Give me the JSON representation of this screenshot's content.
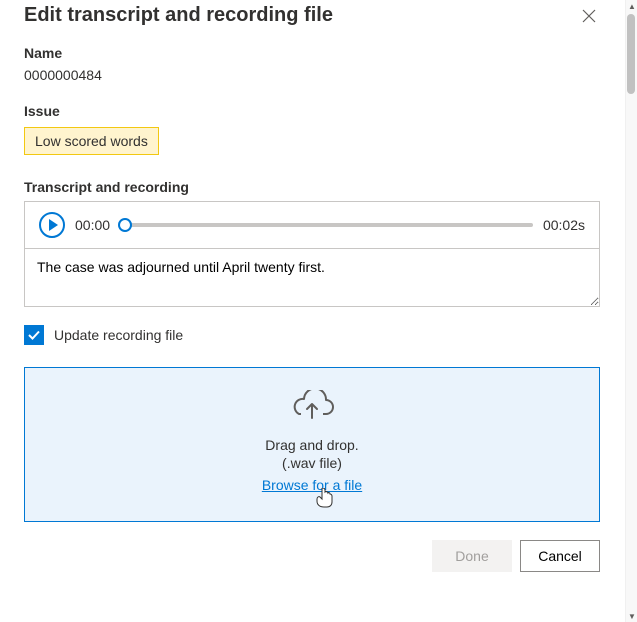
{
  "dialog": {
    "title": "Edit transcript and recording file"
  },
  "name": {
    "label": "Name",
    "value": "0000000484"
  },
  "issue": {
    "label": "Issue",
    "chips": [
      "Low scored words"
    ]
  },
  "transcript": {
    "label": "Transcript and recording",
    "current_time": "00:00",
    "duration": "00:02s",
    "text": "The case was adjourned until April twenty first."
  },
  "update_checkbox": {
    "checked": true,
    "label": "Update recording file"
  },
  "dropzone": {
    "line1": "Drag and drop.",
    "line2": "(.wav file)",
    "link": "Browse for a file"
  },
  "footer": {
    "done": "Done",
    "cancel": "Cancel",
    "done_enabled": false
  }
}
